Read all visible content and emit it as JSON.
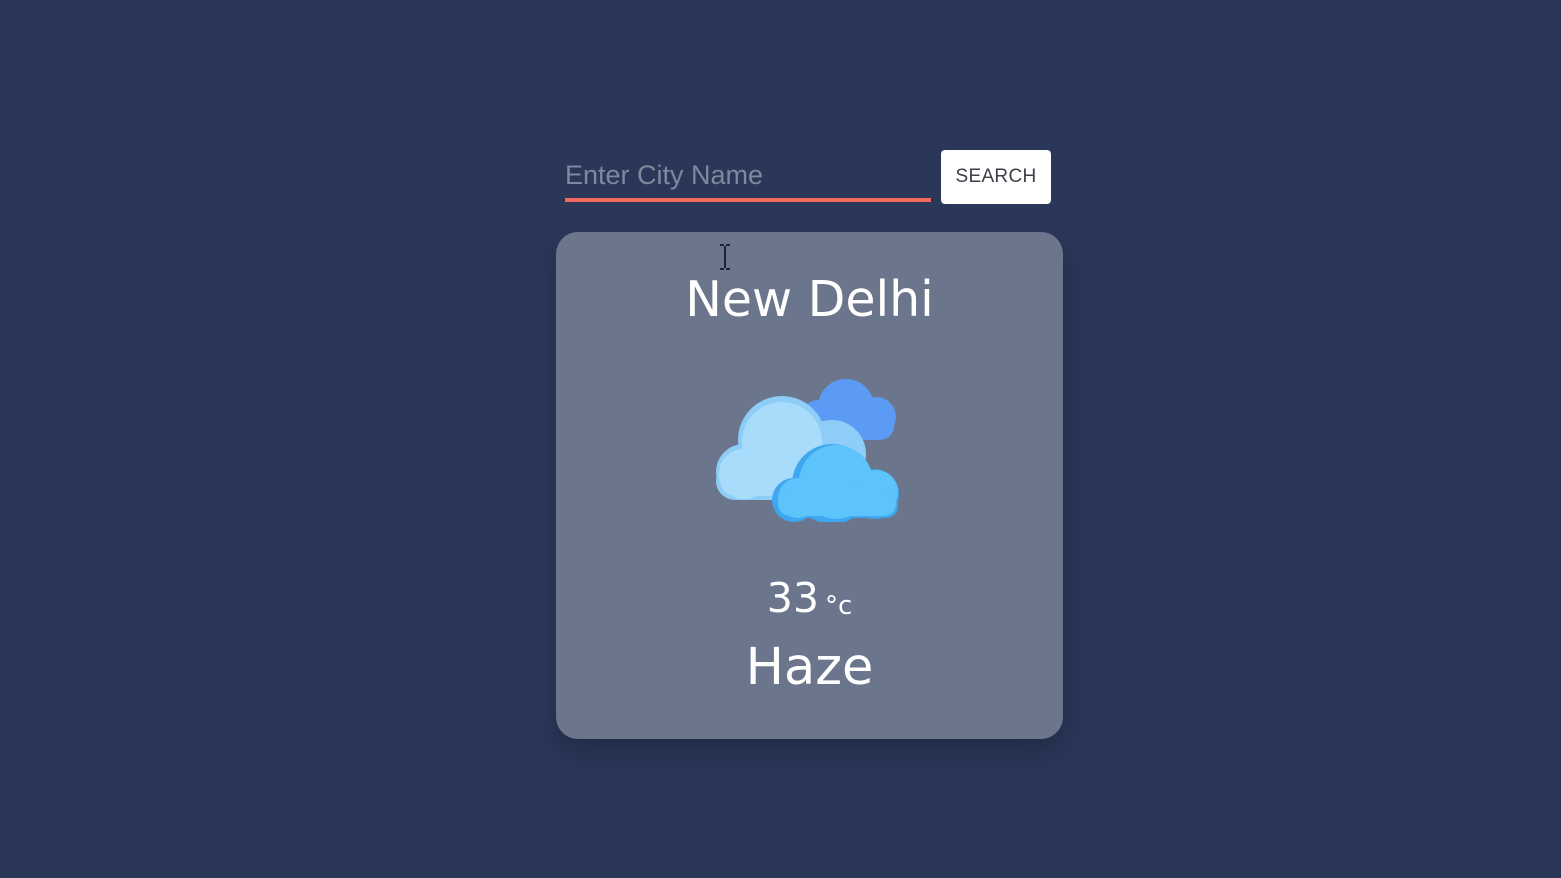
{
  "search": {
    "placeholder": "Enter City Name",
    "value": "",
    "button_label": "SEARCH",
    "underline_color": "#f26a5f"
  },
  "weather": {
    "city": "New Delhi",
    "icon": "clouds-icon",
    "temperature": "33",
    "unit": "°c",
    "condition": "Haze"
  },
  "colors": {
    "background": "#2a3759",
    "card": "#6b768c",
    "accent": "#f26a5f"
  }
}
